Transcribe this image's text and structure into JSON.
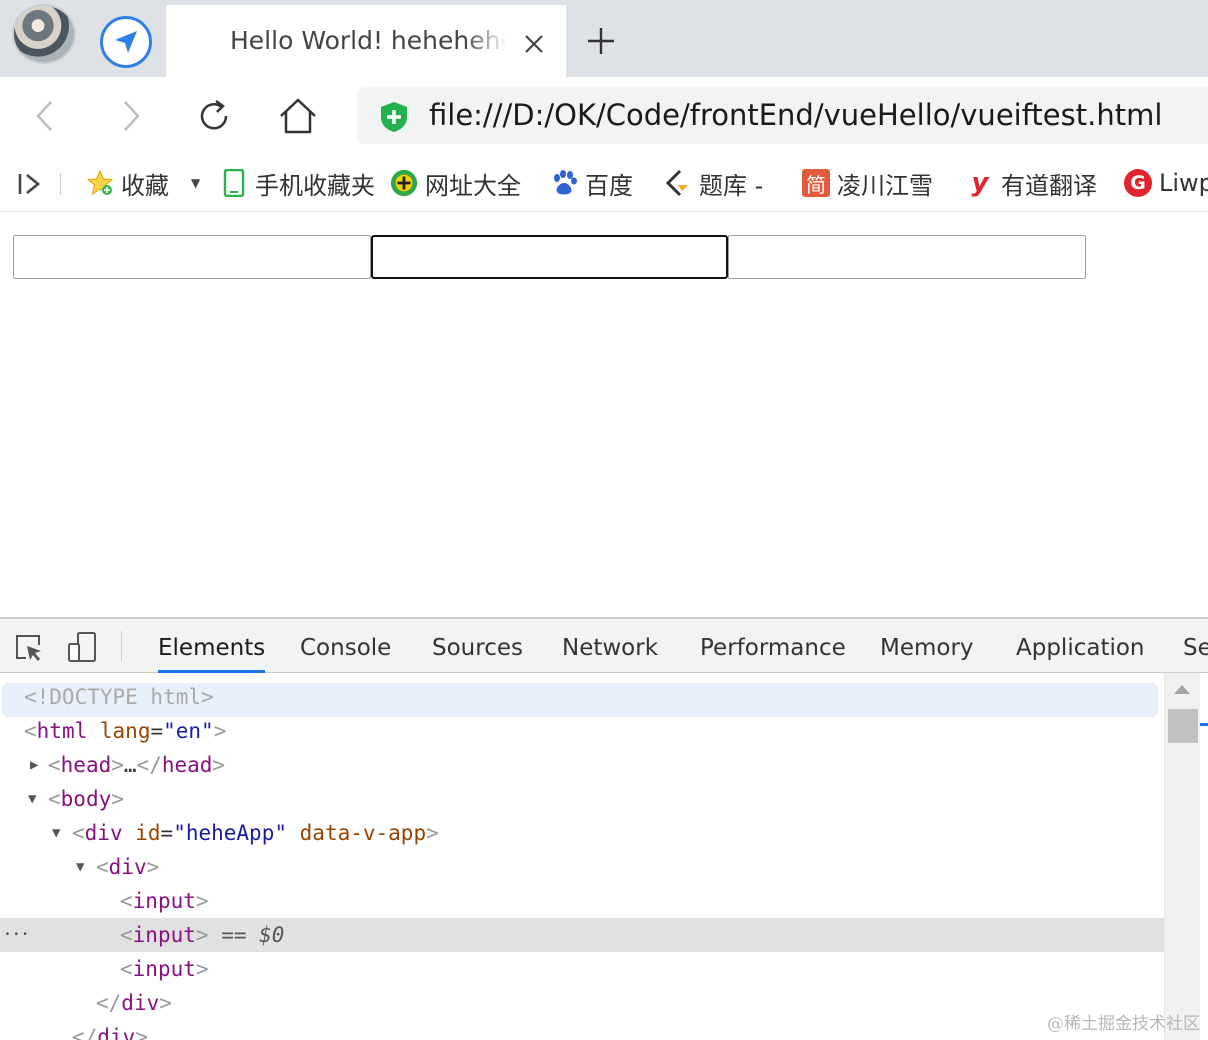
{
  "browser": {
    "tab": {
      "title": "Hello World! hehehehehe"
    },
    "address": {
      "url": "file:///D:/OK/Code/frontEnd/vueHello/vueiftest.html"
    },
    "bookmarks": [
      {
        "label": "收藏",
        "icon": "star-icon"
      },
      {
        "label": "手机收藏夹",
        "icon": "phone-icon"
      },
      {
        "label": "网址大全",
        "icon": "site-directory-icon"
      },
      {
        "label": "百度",
        "icon": "baidu-paw-icon"
      },
      {
        "label": "题库 -",
        "icon": "quiz-icon"
      },
      {
        "label": "凌川江雪",
        "icon": "jian-icon",
        "icon_text": "简"
      },
      {
        "label": "有道翻译",
        "icon": "youdao-icon",
        "icon_text": "y"
      },
      {
        "label": "Liwp",
        "icon": "g-icon",
        "icon_text": "G"
      }
    ]
  },
  "page": {
    "inputs": [
      {
        "value": ""
      },
      {
        "value": ""
      },
      {
        "value": ""
      }
    ]
  },
  "devtools": {
    "tabs": [
      "Elements",
      "Console",
      "Sources",
      "Network",
      "Performance",
      "Memory",
      "Application",
      "Se"
    ],
    "active_tab": "Elements",
    "dom": {
      "doctype": "<!DOCTYPE html>",
      "html_tag": "html",
      "html_attr": "lang",
      "html_val": "\"en\"",
      "head_tag": "head",
      "head_ellipsis": "…",
      "body_tag": "body",
      "div_tag": "div",
      "div_id_attr": "id",
      "div_id_val": "\"heheApp\"",
      "div_data_attr": "data-v-app",
      "inner_div_tag": "div",
      "input_tag": "input",
      "selected_marker": "== $0",
      "dots": "···"
    }
  },
  "watermark": "@稀土掘金技术社区",
  "colors": {
    "accent": "#1a73e8",
    "tag": "#881280",
    "attr": "#994500",
    "value": "#1a1aa6"
  }
}
